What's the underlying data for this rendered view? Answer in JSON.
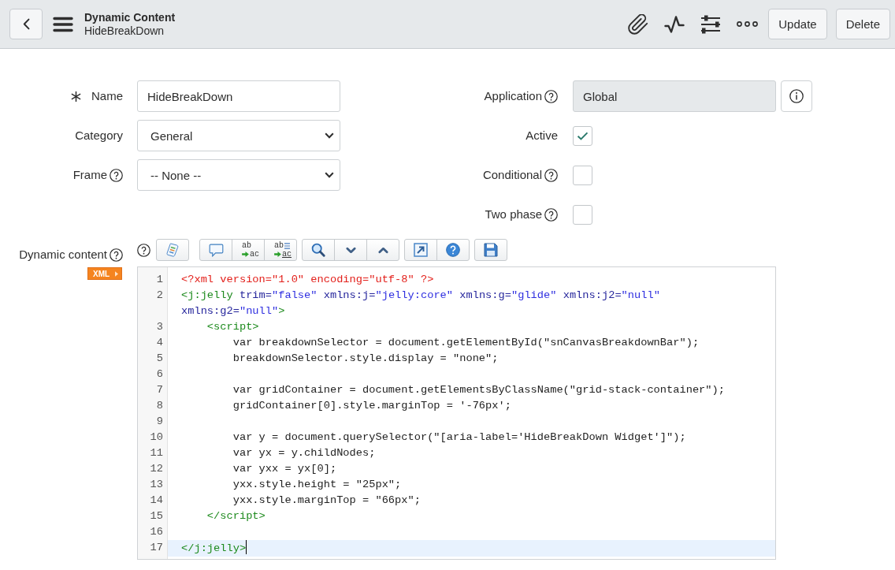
{
  "header": {
    "title": "Dynamic Content",
    "subtitle": "HideBreakDown",
    "buttons": [
      "Update",
      "Delete"
    ]
  },
  "form": {
    "left": [
      {
        "kind": "text",
        "label": "Name",
        "required": true,
        "help": false,
        "value": "HideBreakDown"
      },
      {
        "kind": "select",
        "label": "Category",
        "required": false,
        "help": false,
        "value": "General"
      },
      {
        "kind": "select",
        "label": "Frame",
        "required": false,
        "help": true,
        "value": "-- None --"
      }
    ],
    "right": [
      {
        "kind": "reference",
        "label": "Application",
        "help": true,
        "readonly": true,
        "value": "Global"
      },
      {
        "kind": "checkbox",
        "label": "Active",
        "help": false,
        "checked": true
      },
      {
        "kind": "checkbox",
        "label": "Conditional",
        "help": true,
        "checked": false
      },
      {
        "kind": "checkbox",
        "label": "Two phase",
        "help": true,
        "checked": false
      }
    ]
  },
  "script": {
    "label": "Dynamic content",
    "help": true,
    "mode": "XML",
    "toolbar": {
      "help": true,
      "groups": [
        {
          "buttons": [
            {
              "kind": "format"
            }
          ]
        },
        {
          "buttons": [
            {
              "kind": "comment"
            },
            {
              "kind": "replace",
              "top_text": "ab",
              "bottom_text": "ac"
            },
            {
              "kind": "replace_all",
              "top_text": "ab",
              "bottom_text": "ac"
            }
          ]
        },
        {
          "buttons": [
            {
              "kind": "search"
            },
            {
              "kind": "next"
            },
            {
              "kind": "previous"
            }
          ]
        },
        {
          "buttons": [
            {
              "kind": "fullscreen"
            },
            {
              "kind": "help"
            }
          ]
        },
        {
          "buttons": [
            {
              "kind": "save"
            }
          ]
        }
      ]
    },
    "lines": [
      {
        "number": "1",
        "active": false,
        "tokens": [
          {
            "kind": "pi",
            "text": "<?xml version=\"1.0\" encoding=\"utf-8\" ?>"
          }
        ]
      },
      {
        "number": "2",
        "active": false,
        "tokens": [
          {
            "kind": "tag",
            "text": "<j:jelly"
          },
          {
            "kind": "attr",
            "text": " trim="
          },
          {
            "kind": "string",
            "text": "\"false\""
          },
          {
            "kind": "attr",
            "text": " xmlns:j="
          },
          {
            "kind": "string",
            "text": "\"jelly:core\""
          },
          {
            "kind": "attr",
            "text": " xmlns:g="
          },
          {
            "kind": "string",
            "text": "\"glide\""
          },
          {
            "kind": "attr",
            "text": " xmlns:j2="
          },
          {
            "kind": "string",
            "text": "\"null\""
          },
          {
            "kind": "attr",
            "text": " xmlns:g2="
          },
          {
            "kind": "string",
            "text": "\"null\""
          },
          {
            "kind": "tag",
            "text": ">"
          }
        ]
      },
      {
        "number": "3",
        "active": false,
        "tokens": [
          {
            "kind": "tag",
            "text": "    <script>"
          }
        ]
      },
      {
        "number": "4",
        "active": false,
        "tokens": [
          {
            "kind": "plain",
            "text": "        var breakdownSelector = document.getElementById(\"snCanvasBreakdownBar\");"
          }
        ]
      },
      {
        "number": "5",
        "active": false,
        "tokens": [
          {
            "kind": "plain",
            "text": "        breakdownSelector.style.display = \"none\";"
          }
        ]
      },
      {
        "number": "6",
        "active": false
      },
      {
        "number": "7",
        "active": false,
        "tokens": [
          {
            "kind": "plain",
            "text": "        var gridContainer = document.getElementsByClassName(\"grid-stack-container\");"
          }
        ]
      },
      {
        "number": "8",
        "active": false,
        "tokens": [
          {
            "kind": "plain",
            "text": "        gridContainer[0].style.marginTop = '-76px';"
          }
        ]
      },
      {
        "number": "9",
        "active": false
      },
      {
        "number": "10",
        "active": false,
        "tokens": [
          {
            "kind": "plain",
            "text": "        var y = document.querySelector(\"[aria-label='HideBreakDown Widget']\");"
          }
        ]
      },
      {
        "number": "11",
        "active": false,
        "tokens": [
          {
            "kind": "plain",
            "text": "        var yx = y.childNodes;"
          }
        ]
      },
      {
        "number": "12",
        "active": false,
        "tokens": [
          {
            "kind": "plain",
            "text": "        var yxx = yx[0];"
          }
        ]
      },
      {
        "number": "13",
        "active": false,
        "tokens": [
          {
            "kind": "plain",
            "text": "        yxx.style.height = \"25px\";"
          }
        ]
      },
      {
        "number": "14",
        "active": false,
        "tokens": [
          {
            "kind": "plain",
            "text": "        yxx.style.marginTop = \"66px\";"
          }
        ]
      },
      {
        "number": "15",
        "active": false,
        "tokens": [
          {
            "kind": "tag",
            "text": "    </script>"
          }
        ]
      },
      {
        "number": "16",
        "active": false
      },
      {
        "number": "17",
        "active": true,
        "tokens": [
          {
            "kind": "tag",
            "text": "</j:jelly>"
          }
        ]
      }
    ]
  }
}
